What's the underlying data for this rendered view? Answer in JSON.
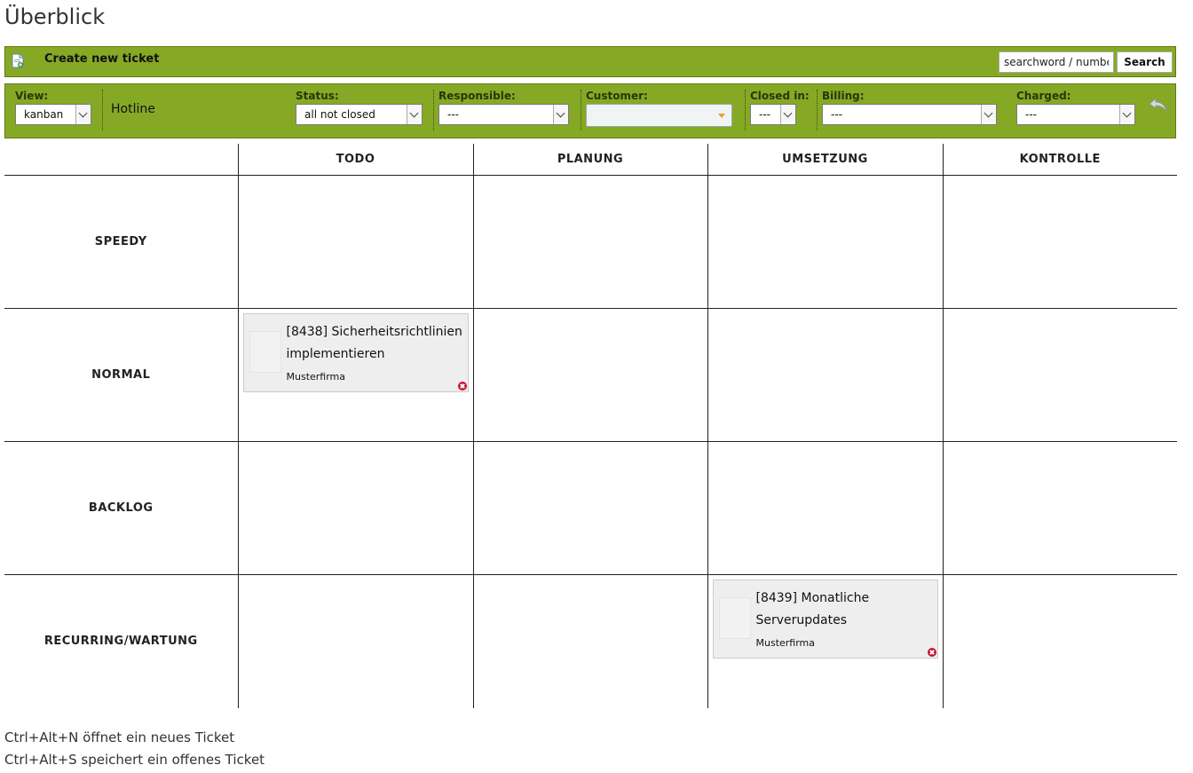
{
  "page": {
    "title": "Überblick"
  },
  "toolbar": {
    "new_ticket_icon": "new-document-icon",
    "new_ticket_label": "Create new ticket",
    "search_value": "searchword / numbe",
    "search_label": "Search"
  },
  "filters": {
    "view": {
      "label": "View:",
      "value": "kanban"
    },
    "hotline": "Hotline",
    "status": {
      "label": "Status:",
      "value": "all not closed"
    },
    "responsible": {
      "label": "Responsible:",
      "value": "---"
    },
    "customer": {
      "label": "Customer:",
      "value": ""
    },
    "closed_in": {
      "label": "Closed in:",
      "value": "---"
    },
    "billing": {
      "label": "Billing:",
      "value": "---"
    },
    "charged": {
      "label": "Charged:",
      "value": "---"
    },
    "reset_icon": "undo-arrow-icon"
  },
  "board": {
    "columns": [
      "TODO",
      "PLANUNG",
      "UMSETZUNG",
      "KONTROLLE"
    ],
    "rows": [
      "SPEEDY",
      "NORMAL",
      "BACKLOG",
      "RECURRING/WARTUNG"
    ],
    "tickets": [
      {
        "row": 1,
        "col": 0,
        "title": "[8438] Sicherheitsrichtlinien implementieren",
        "customer": "Musterfirma"
      },
      {
        "row": 3,
        "col": 2,
        "title": "[8439] Monatliche Serverupdates",
        "customer": "Musterfirma"
      }
    ]
  },
  "hints": [
    "Ctrl+Alt+N öffnet ein neues Ticket",
    "Ctrl+Alt+S speichert ein offenes Ticket"
  ],
  "colors": {
    "bar": "#86a925",
    "delete": "#c8102e",
    "ticket_bg": "#eeeeee"
  }
}
